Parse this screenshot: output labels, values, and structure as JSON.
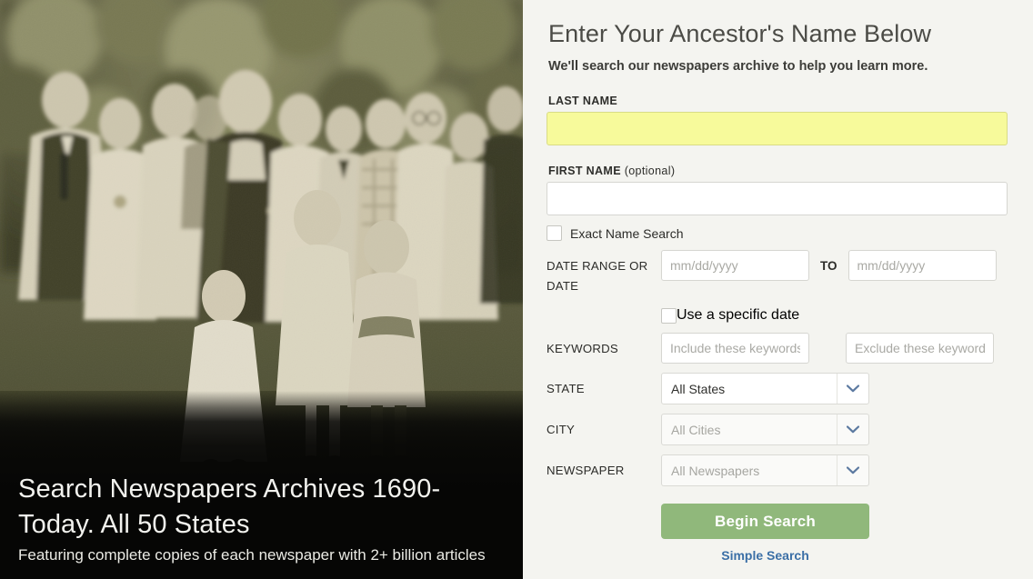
{
  "hero": {
    "photo_alt": "vintage-sepia-family-group-portrait",
    "title": "Search Newspapers Archives 1690-Today. All 50 States",
    "subtitle": "Featuring complete copies of each newspaper with 2+ billion articles"
  },
  "form": {
    "heading": "Enter Your Ancestor's Name Below",
    "subheading": "We'll search our newspapers archive to help you learn more.",
    "last_name": {
      "label": "LAST NAME",
      "value": "",
      "placeholder": ""
    },
    "first_name": {
      "label": "FIRST NAME",
      "optional_suffix": "(optional)",
      "value": "",
      "placeholder": ""
    },
    "exact_name": {
      "label": "Exact Name Search",
      "checked": false
    },
    "date_range": {
      "label": "DATE RANGE OR DATE",
      "from_placeholder": "mm/dd/yyyy",
      "from_value": "",
      "to_label": "TO",
      "to_placeholder": "mm/dd/yyyy",
      "to_value": ""
    },
    "specific_date": {
      "label": "Use a specific date",
      "checked": false
    },
    "keywords": {
      "label": "KEYWORDS",
      "include_placeholder": "Include these keywords...",
      "include_value": "",
      "exclude_placeholder": "Exclude these keywords...",
      "exclude_value": ""
    },
    "state": {
      "label": "STATE",
      "selected": "All States",
      "disabled": false
    },
    "city": {
      "label": "CITY",
      "selected": "All Cities",
      "disabled": true
    },
    "newspaper": {
      "label": "NEWSPAPER",
      "selected": "All Newspapers",
      "disabled": true
    },
    "submit_label": "Begin Search",
    "simple_search_label": "Simple Search"
  },
  "colors": {
    "panel_bg": "#f4f4f0",
    "highlight_field": "#f7fa9b",
    "submit_green": "#90b87b",
    "link_blue": "#3b6fa6",
    "chevron": "#5b79a0"
  },
  "icons": {
    "chevron_down": "chevron-down-icon"
  }
}
